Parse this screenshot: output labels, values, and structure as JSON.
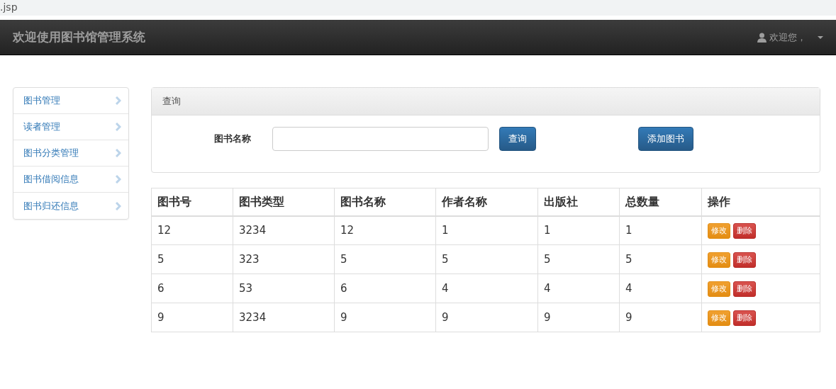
{
  "address_bar": {
    "text": ".jsp"
  },
  "navbar": {
    "brand": "欢迎使用图书馆管理系统",
    "user_menu": "欢迎您，"
  },
  "sidebar": {
    "items": [
      {
        "label": "图书管理"
      },
      {
        "label": "读者管理"
      },
      {
        "label": "图书分类管理"
      },
      {
        "label": "图书借阅信息"
      },
      {
        "label": "图书归还信息"
      }
    ]
  },
  "search_panel": {
    "title": "查询",
    "field_label": "图书名称",
    "search_button": "查询",
    "add_button": "添加图书"
  },
  "table": {
    "columns": [
      "图书号",
      "图书类型",
      "图书名称",
      "作者名称",
      "出版社",
      "总数量",
      "操作"
    ],
    "rows": [
      {
        "cells": [
          "12",
          "3234",
          "12",
          "1",
          "1",
          "1"
        ],
        "actions": [
          "修改",
          "删除"
        ]
      },
      {
        "cells": [
          "5",
          "323",
          "5",
          "5",
          "5",
          "5"
        ],
        "actions": [
          "修改",
          "删除"
        ]
      },
      {
        "cells": [
          "6",
          "53",
          "6",
          "4",
          "4",
          "4"
        ],
        "actions": [
          "修改",
          "删除"
        ]
      },
      {
        "cells": [
          "9",
          "3234",
          "9",
          "9",
          "9",
          "9"
        ],
        "actions": [
          "修改",
          "删除"
        ]
      }
    ]
  }
}
